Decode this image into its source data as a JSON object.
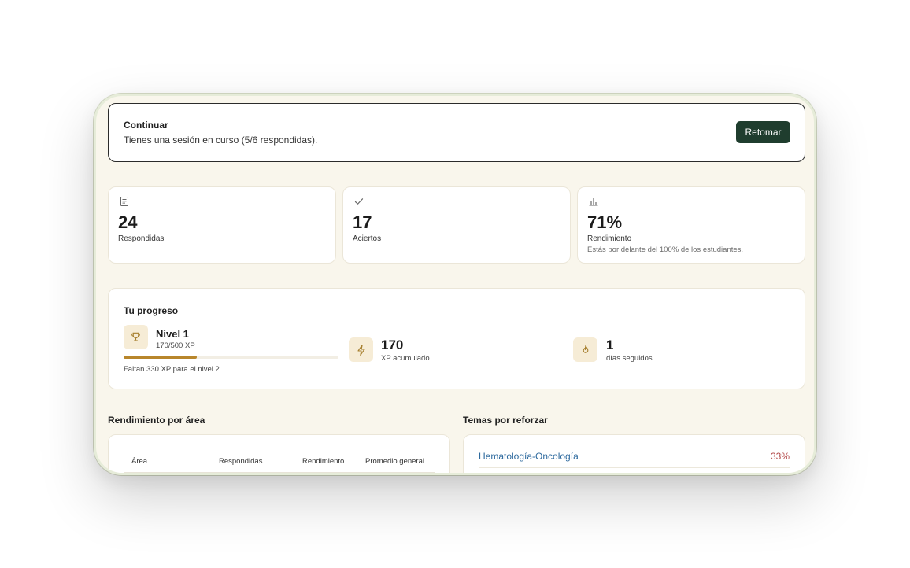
{
  "continue_banner": {
    "title": "Continuar",
    "subtitle": "Tienes una sesión en curso (5/6 respondidas).",
    "button_label": "Retomar"
  },
  "stats": [
    {
      "icon": "document-icon",
      "value": "24",
      "label": "Respondidas",
      "note": ""
    },
    {
      "icon": "check-icon",
      "value": "17",
      "label": "Aciertos",
      "note": ""
    },
    {
      "icon": "bar-chart-icon",
      "value": "71%",
      "label": "Rendimiento",
      "note": "Estás por delante del 100% de los estudiantes."
    }
  ],
  "progress": {
    "title": "Tu progreso",
    "level": {
      "icon": "trophy-icon",
      "name": "Nivel 1",
      "xp_text": "170/500 XP",
      "fraction": 0.34,
      "remaining_text": "Faltan 330 XP para el nivel 2"
    },
    "xp": {
      "icon": "lightning-icon",
      "value": "170",
      "label": "XP acumulado"
    },
    "streak": {
      "icon": "flame-icon",
      "value": "1",
      "label": "días seguidos"
    }
  },
  "area_performance": {
    "title": "Rendimiento por área",
    "columns": [
      "Área",
      "Respondidas",
      "Rendimiento",
      "Promedio general"
    ]
  },
  "topics_to_reinforce": {
    "title": "Temas por reforzar",
    "items": [
      {
        "name": "Hematología-Oncología",
        "percent": "33%"
      }
    ]
  },
  "colors": {
    "background": "#f9f6ec",
    "primary_button": "#1f3d2e",
    "accent_gold": "#b8862b",
    "badge_bg": "#f6ecd6",
    "link_blue": "#2e6a9e",
    "percent_red": "#b34a4a"
  }
}
